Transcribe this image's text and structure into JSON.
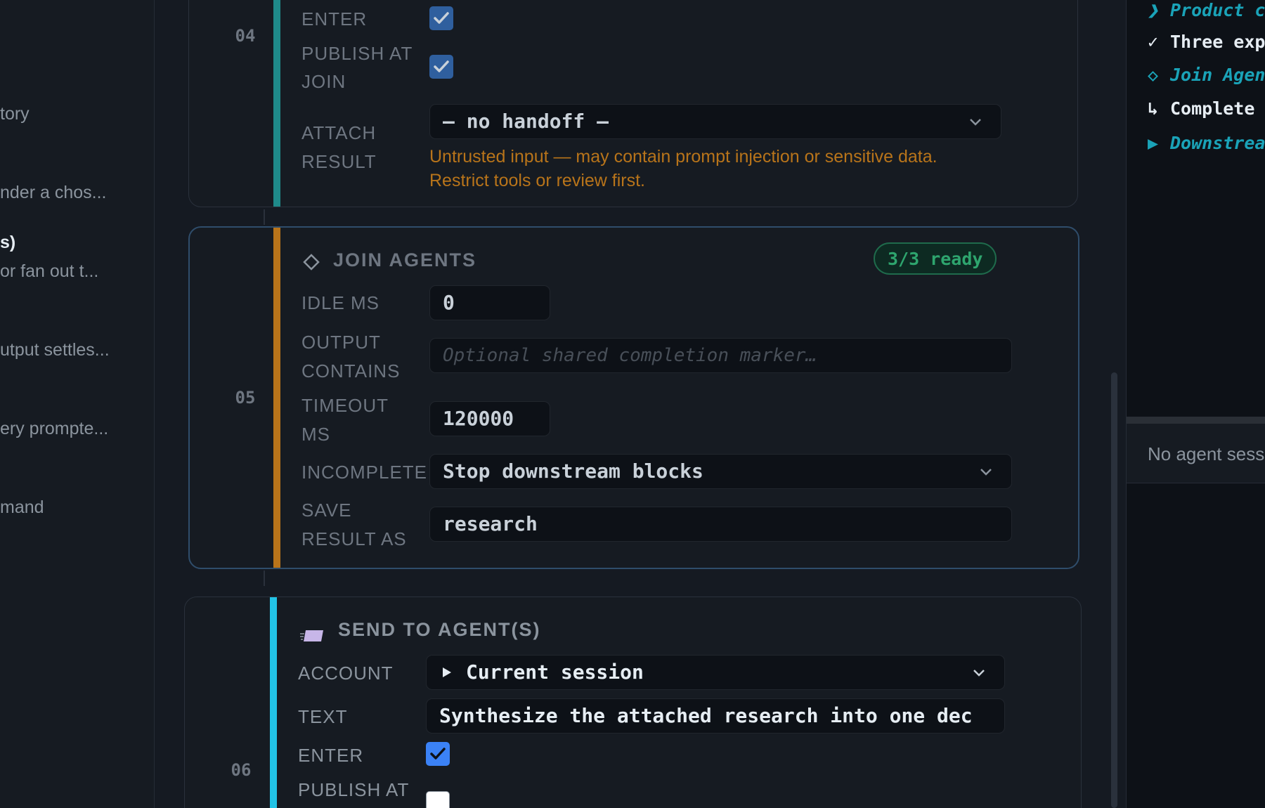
{
  "sidebar": {
    "items": [
      {
        "text": "tory"
      },
      {
        "text": "nder a chos..."
      },
      {
        "text": "s)"
      },
      {
        "text": "or fan out t..."
      },
      {
        "text": "utput settles..."
      },
      {
        "text": "ery prompte..."
      },
      {
        "text": "mand"
      }
    ]
  },
  "block04": {
    "number": "04",
    "enter_label": "ENTER",
    "enter_checked": true,
    "publish_label_1": "PUBLISH AT",
    "publish_label_2": "JOIN",
    "publish_checked": true,
    "attach_label_1": "ATTACH",
    "attach_label_2": "RESULT",
    "attach_value": "— no handoff —",
    "warning_1": "Untrusted input — may contain prompt injection or sensitive data.",
    "warning_2": "Restrict tools or review first.",
    "accent": "#1f8a8a"
  },
  "block05": {
    "number": "05",
    "title": "JOIN AGENTS",
    "icon": "diamond-icon",
    "badge": "3/3 ready",
    "idle_label": "IDLE MS",
    "idle_value": "0",
    "output_label_1": "OUTPUT",
    "output_label_2": "CONTAINS",
    "output_placeholder": "Optional shared completion marker…",
    "timeout_label_1": "TIMEOUT",
    "timeout_label_2": "MS",
    "timeout_value": "120000",
    "incomplete_label": "INCOMPLETE",
    "incomplete_value": "Stop downstream blocks",
    "save_label_1": "SAVE",
    "save_label_2": "RESULT AS",
    "save_value": "research",
    "accent": "#b8741a"
  },
  "block06": {
    "number": "06",
    "title": "SEND TO AGENT(S)",
    "icon": "send-icon",
    "account_label": "ACCOUNT",
    "account_value": "Current session",
    "account_icon": "play-icon",
    "text_label": "TEXT",
    "text_value": "Synthesize the attached research into one dec",
    "enter_label": "ENTER",
    "enter_checked": true,
    "publish_label": "PUBLISH AT",
    "publish_checked": false,
    "accent": "#22c3e6"
  },
  "right_panel": {
    "lines": [
      {
        "glyph": "❯",
        "text": "Product c",
        "color": "#1aa3b8",
        "italic": true
      },
      {
        "glyph": "✓",
        "text": "Three exp",
        "color": "#e6edf3",
        "italic": false
      },
      {
        "glyph": "◇",
        "text": "Join Agen",
        "color": "#1aa3b8",
        "italic": true
      },
      {
        "glyph": "↳",
        "text": "Complete",
        "color": "#e6edf3",
        "italic": false
      },
      {
        "glyph": "▶",
        "text": "Downstrea",
        "color": "#1aa3b8",
        "italic": true
      }
    ],
    "status": "No agent sess"
  }
}
